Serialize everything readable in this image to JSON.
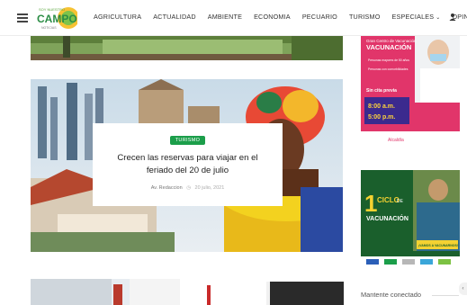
{
  "header": {
    "logo_top": "SOY NUESTRO",
    "logo_main": "CAMPO",
    "logo_sub": "NOTICIAS",
    "nav": [
      "AGRICULTURA",
      "ACTUALIDAD",
      "AMBIENTE",
      "ECONOMIA",
      "PECUARIO",
      "TURISMO",
      "ESPECIALES",
      "OPINIÓN"
    ],
    "nav_dropdown_chevron": "⌄"
  },
  "hero": {
    "category": "TURISMO",
    "title": "Crecen las reservas para viajar en el feriado del 20 de julio",
    "author": "Av. Redaccion",
    "date": "20 julio, 2021"
  },
  "ad_vaccination": {
    "headline_1": "Gran Centro de Vacunación",
    "headline_2": "VACUNACIÓN",
    "line_1": "Personas mayores de 50 años",
    "line_2": "Personas con comorbilidades",
    "cita": "Sin cita previa",
    "hours_1": "8:00 a.m.",
    "hours_2": "5:00 p.m.",
    "footer": "Alcaldía"
  },
  "ad_ciclo": {
    "big": "1",
    "line_1": "CICLO",
    "line_2": "DE",
    "line_3": "VACUNACIÓN",
    "slogan": "¡VAMOS A VACUNARNOS!"
  },
  "sidebar": {
    "connected_label": "Mantente conectado"
  },
  "colors": {
    "accent_green": "#1b9e4a",
    "ad_pink": "#e1356a",
    "ad_green": "#1a5f2c"
  }
}
